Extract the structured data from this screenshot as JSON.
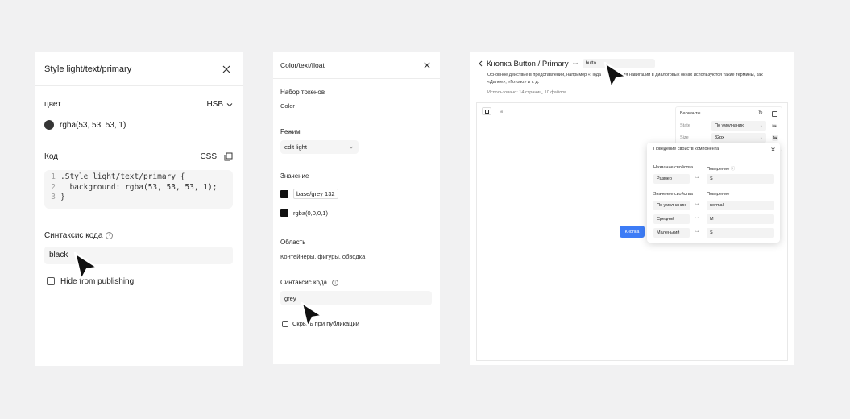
{
  "panel1": {
    "title": "Style light/text/primary",
    "color_label": "цвет",
    "color_mode": "HSB",
    "color_value": "rgba(53, 53, 53, 1)",
    "code_label": "Код",
    "code_lang": "CSS",
    "code_lines": [
      {
        "n": "1",
        "t": ".Style light/text/primary {"
      },
      {
        "n": "2",
        "t": "  background: rgba(53, 53, 53, 1);"
      },
      {
        "n": "3",
        "t": "}"
      }
    ],
    "syntax_label": "Синтаксис кода",
    "syntax_value": "black",
    "hide_label": "Hide from publishing"
  },
  "panel2": {
    "title": "Color/text/float",
    "token_set_label": "Набор токенов",
    "token_set_value": "Color",
    "mode_label": "Режим",
    "mode_value": "edit light",
    "value_label": "Значение",
    "value_token": "base/grey 132",
    "value_rgba": "rgba(0,0,0,1)",
    "scope_label": "Область",
    "scope_value": "Контейнеры, фигуры, обводка",
    "syntax_label": "Синтаксис кода",
    "syntax_value": "grey",
    "hide_label": "Скрыть при публикации"
  },
  "panel3": {
    "title": "Кнопка Button / Primary",
    "link_tag": "butto",
    "desc_line1": "Основное действие в представлении, например «Пода",
    "desc_line1b": "для навигации в диалоговых окнах используются такие термины, как",
    "desc_line2": "«Далее», «Готово» и т. д.",
    "usage": "Использовано: 14 страниц, 10 файлов",
    "variants_title": "Варианты",
    "variants": [
      {
        "label": "State",
        "value": "По умолчанию"
      },
      {
        "label": "Size",
        "value": "32px"
      }
    ],
    "button_label": "Кнопка",
    "popup": {
      "title": "Поведение свойств компонента",
      "prop_name_header": "Название свойства",
      "behavior_header": "Поведение",
      "prop_row": {
        "name": "Размер",
        "value": "S"
      },
      "value_header": "Значение свойства",
      "behavior_header2": "Поведение",
      "rows": [
        {
          "name": "По умолчанию",
          "value": "normal"
        },
        {
          "name": "Средний",
          "value": "M"
        },
        {
          "name": "Маленький",
          "value": "S"
        }
      ]
    },
    "accent": "#3d7cf6"
  }
}
